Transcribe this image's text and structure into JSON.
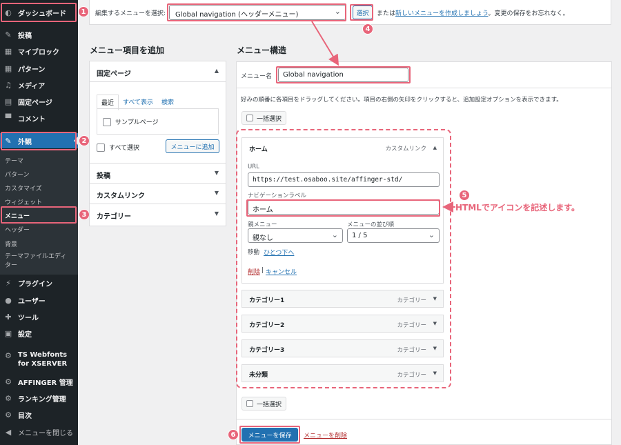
{
  "sidebar": {
    "items": [
      {
        "label": "ダッシュボード",
        "icon": "dashboard-icon",
        "glyph": "◐"
      },
      {
        "label": "投稿",
        "icon": "pin-icon",
        "glyph": "✎"
      },
      {
        "label": "マイブロック",
        "icon": "blocks-icon",
        "glyph": "▦"
      },
      {
        "label": "パターン",
        "icon": "patterns-icon",
        "glyph": "▦"
      },
      {
        "label": "メディア",
        "icon": "media-icon",
        "glyph": "♫"
      },
      {
        "label": "固定ページ",
        "icon": "page-icon",
        "glyph": "▤"
      },
      {
        "label": "コメント",
        "icon": "comment-icon",
        "glyph": "▀"
      },
      {
        "label": "外観",
        "icon": "appearance-icon",
        "glyph": "✎"
      },
      {
        "label": "プラグイン",
        "icon": "plugin-icon",
        "glyph": "⚡"
      },
      {
        "label": "ユーザー",
        "icon": "user-icon",
        "glyph": "●"
      },
      {
        "label": "ツール",
        "icon": "tools-icon",
        "glyph": "✚"
      },
      {
        "label": "設定",
        "icon": "settings-icon",
        "glyph": "▣"
      },
      {
        "label": "TS Webfonts for XSERVER",
        "icon": "gear-icon",
        "glyph": "⚙"
      },
      {
        "label": "AFFINGER 管理",
        "icon": "gear-icon",
        "glyph": "⚙"
      },
      {
        "label": "ランキング管理",
        "icon": "gear-icon",
        "glyph": "⚙"
      },
      {
        "label": "目次",
        "icon": "gear-icon",
        "glyph": "⚙"
      },
      {
        "label": "メニューを閉じる",
        "icon": "collapse-icon",
        "glyph": "◀"
      }
    ],
    "submenu": [
      "テーマ",
      "パターン",
      "カスタマイズ",
      "ウィジェット",
      "メニュー",
      "ヘッダー",
      "背景",
      "テーマファイルエディター"
    ]
  },
  "topbar": {
    "select_label": "編集するメニューを選択:",
    "selected_menu": "Global navigation (ヘッダーメニュー)",
    "select_button": "選択",
    "or_text": "または",
    "create_link": "新しいメニューを作成しましょう",
    "reminder": "。変更の保存をお忘れなく。"
  },
  "add_items": {
    "heading": "メニュー項目を追加",
    "fixed_pages": "固定ページ",
    "tabs": [
      "最近",
      "すべて表示",
      "検索"
    ],
    "sample_page": "サンプルページ",
    "select_all": "すべて選択",
    "add_button": "メニューに追加",
    "posts": "投稿",
    "custom_link": "カスタムリンク",
    "category": "カテゴリー"
  },
  "structure": {
    "heading": "メニュー構造",
    "name_label": "メニュー名",
    "name_value": "Global navigation",
    "instructions": "好みの順番に各項目をドラッグしてください。項目の右側の矢印をクリックすると、追加設定オプションを表示できます。",
    "bulk_select": "一括選択",
    "home_item": {
      "title": "ホーム",
      "type": "カスタムリンク",
      "url_label": "URL",
      "url_value": "https://test.osaboo.site/affinger-std/",
      "nav_label_label": "ナビゲーションラベル",
      "nav_label_value": "ホーム",
      "parent_label": "親メニュー",
      "parent_value": "親なし",
      "order_label": "メニューの並び順",
      "order_value": "1 / 5",
      "move_label": "移動",
      "move_link": "ひとつ下へ",
      "delete_link": "削除",
      "separator": "|",
      "cancel_link": "キャンセル"
    },
    "items": [
      {
        "title": "カテゴリー1",
        "type": "カテゴリー"
      },
      {
        "title": "カテゴリー2",
        "type": "カテゴリー"
      },
      {
        "title": "カテゴリー3",
        "type": "カテゴリー"
      },
      {
        "title": "未分類",
        "type": "カテゴリー"
      }
    ],
    "save_button": "メニューを保存",
    "delete_menu_link": "メニューを削除"
  },
  "annotations": {
    "badges": [
      "1",
      "2",
      "3",
      "4",
      "5",
      "6"
    ],
    "callout": "HTMLでアイコンを記述します。",
    "color": "#e8657a"
  },
  "colors": {
    "sidebar_bg": "#1d2327",
    "accent": "#2271b1",
    "highlight": "#e8657a"
  }
}
